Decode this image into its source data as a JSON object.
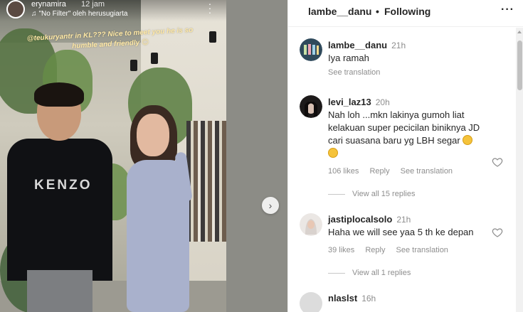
{
  "story": {
    "username": "erynamira",
    "time": "12 jam",
    "music": "\"No Filter\" oleh herusugiarta",
    "caption": "@teukuryantr in KL??? Nice to meet you he is so humble and friendly 😊",
    "shirt_text": "KENZO"
  },
  "post_header": {
    "username": "lambe__danu",
    "separator": "•",
    "follow_status": "Following"
  },
  "comments": [
    {
      "username": "lambe__danu",
      "time": "21h",
      "text": "Iya ramah",
      "see_translation": "See translation"
    },
    {
      "username": "levi_laz13",
      "time": "20h",
      "text_line1": "Nah loh ...mkn lakinya gumoh liat",
      "text_line2": "kelakuan super pecicilan biniknya JD",
      "text_line3": "cari suasana baru yg LBH segar",
      "likes": "106 likes",
      "reply": "Reply",
      "see_translation": "See translation",
      "view_replies": "View all 15 replies"
    },
    {
      "username": "jastiplocalsolo",
      "time": "21h",
      "text": "Haha we will see yaa 5 th ke depan",
      "likes": "39 likes",
      "reply": "Reply",
      "see_translation": "See translation",
      "view_replies": "View all 1 replies"
    },
    {
      "username": "nlaslst",
      "time": "16h"
    }
  ],
  "colors": {
    "text_primary": "#262626",
    "text_secondary": "#8e8e8e",
    "divider": "#efefef"
  }
}
